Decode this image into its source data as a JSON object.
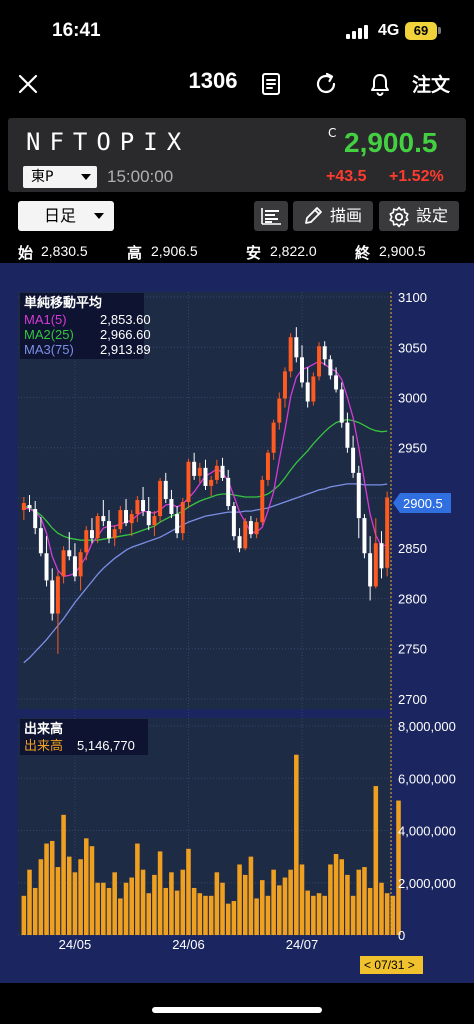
{
  "status_bar": {
    "time": "16:41",
    "network": "4G",
    "battery": "69"
  },
  "nav": {
    "title": "1306",
    "order_label": "注文",
    "icons": [
      "close-icon",
      "document-icon",
      "refresh-icon",
      "bell-icon"
    ]
  },
  "quote": {
    "name": "NFTOPIX",
    "market": "東P",
    "time": "15:00:00",
    "close_marker": "C",
    "price": "2,900.5",
    "change": "+43.5",
    "change_pct": "+1.52%",
    "price_color": "#43d141",
    "change_color": "#ff3b30"
  },
  "toolbar": {
    "period": "日足",
    "draw_label": "描画",
    "settings_label": "設定",
    "icons": [
      "bar-list-icon",
      "pencil-icon",
      "gear-icon"
    ]
  },
  "ohlc": {
    "open_label": "始",
    "open": "2,830.5",
    "high_label": "高",
    "high": "2,906.5",
    "low_label": "安",
    "low": "2,822.0",
    "close_label": "終",
    "close": "2,900.5"
  },
  "indicators": {
    "title": "単純移動平均",
    "ma1_label": "MA1(5)",
    "ma1_value": "2,853.60",
    "ma2_label": "MA2(25)",
    "ma2_value": "2,966.60",
    "ma3_label": "MA3(75)",
    "ma3_value": "2,913.89"
  },
  "volume_legend": {
    "title": "出来高",
    "label": "出来高",
    "value": "5,146,770"
  },
  "current_price_tag": "2900.5",
  "cursor_date": "< 07/31 >",
  "colors": {
    "background": "#1b2660",
    "up": "#ff5a1f",
    "down": "#ffffff",
    "ma1": "#d63ad6",
    "ma2": "#36c43e",
    "ma3": "#7c8fe6",
    "volume": "#f0a020"
  },
  "chart_data": {
    "type": "candlestick",
    "price_axis": {
      "ticks": [
        2700,
        2750,
        2800,
        2850,
        2900,
        2950,
        3000,
        3050,
        3100
      ],
      "range": [
        2690,
        3105
      ]
    },
    "volume_axis": {
      "ticks": [
        0,
        2000000,
        4000000,
        6000000,
        8000000
      ],
      "tick_labels": [
        "0",
        "2,000,000",
        "4,000,000",
        "6,000,000",
        "8,000,000"
      ],
      "range": [
        0,
        8000000
      ]
    },
    "x_tick_labels": [
      {
        "label": "24/05",
        "index": 9
      },
      {
        "label": "24/06",
        "index": 29
      },
      {
        "label": "24/07",
        "index": 49
      }
    ],
    "ohlc": [
      [
        2888,
        2901,
        2878,
        2895
      ],
      [
        2893,
        2903,
        2886,
        2890
      ],
      [
        2889,
        2897,
        2864,
        2870
      ],
      [
        2870,
        2881,
        2842,
        2845
      ],
      [
        2845,
        2862,
        2812,
        2818
      ],
      [
        2818,
        2830,
        2778,
        2785
      ],
      [
        2785,
        2827,
        2745,
        2822
      ],
      [
        2822,
        2852,
        2815,
        2848
      ],
      [
        2848,
        2866,
        2838,
        2842
      ],
      [
        2842,
        2855,
        2817,
        2822
      ],
      [
        2822,
        2849,
        2808,
        2846
      ],
      [
        2846,
        2872,
        2838,
        2868
      ],
      [
        2868,
        2880,
        2855,
        2860
      ],
      [
        2860,
        2885,
        2855,
        2882
      ],
      [
        2882,
        2898,
        2872,
        2877
      ],
      [
        2877,
        2888,
        2855,
        2860
      ],
      [
        2860,
        2873,
        2852,
        2869
      ],
      [
        2869,
        2892,
        2865,
        2888
      ],
      [
        2888,
        2899,
        2872,
        2875
      ],
      [
        2875,
        2888,
        2862,
        2884
      ],
      [
        2884,
        2902,
        2876,
        2898
      ],
      [
        2898,
        2911,
        2882,
        2887
      ],
      [
        2887,
        2901,
        2868,
        2873
      ],
      [
        2873,
        2887,
        2862,
        2882
      ],
      [
        2882,
        2920,
        2876,
        2917
      ],
      [
        2917,
        2925,
        2895,
        2899
      ],
      [
        2899,
        2908,
        2880,
        2884
      ],
      [
        2884,
        2892,
        2860,
        2865
      ],
      [
        2865,
        2900,
        2858,
        2896
      ],
      [
        2896,
        2939,
        2890,
        2936
      ],
      [
        2936,
        2945,
        2918,
        2922
      ],
      [
        2922,
        2935,
        2915,
        2930
      ],
      [
        2930,
        2938,
        2908,
        2912
      ],
      [
        2912,
        2922,
        2902,
        2918
      ],
      [
        2918,
        2938,
        2914,
        2932
      ],
      [
        2932,
        2940,
        2917,
        2920
      ],
      [
        2920,
        2928,
        2888,
        2892
      ],
      [
        2892,
        2896,
        2858,
        2862
      ],
      [
        2862,
        2870,
        2846,
        2850
      ],
      [
        2850,
        2880,
        2848,
        2877
      ],
      [
        2877,
        2882,
        2860,
        2864
      ],
      [
        2864,
        2880,
        2860,
        2876
      ],
      [
        2876,
        2922,
        2873,
        2918
      ],
      [
        2918,
        2948,
        2912,
        2945
      ],
      [
        2945,
        2978,
        2938,
        2975
      ],
      [
        2975,
        3005,
        2968,
        2999
      ],
      [
        2999,
        3030,
        2990,
        3026
      ],
      [
        3026,
        3064,
        3020,
        3060
      ],
      [
        3060,
        3070,
        3035,
        3040
      ],
      [
        3040,
        3052,
        3010,
        3015
      ],
      [
        3015,
        3030,
        2990,
        2996
      ],
      [
        2996,
        3025,
        2992,
        3021
      ],
      [
        3021,
        3055,
        3017,
        3051
      ],
      [
        3051,
        3056,
        3032,
        3038
      ],
      [
        3038,
        3042,
        3018,
        3022
      ],
      [
        3022,
        3030,
        3005,
        3008
      ],
      [
        3008,
        3015,
        2970,
        2975
      ],
      [
        2975,
        2985,
        2945,
        2950
      ],
      [
        2950,
        2962,
        2920,
        2925
      ],
      [
        2925,
        2932,
        2860,
        2880
      ],
      [
        2880,
        2884,
        2840,
        2845
      ],
      [
        2845,
        2862,
        2798,
        2812
      ],
      [
        2812,
        2880,
        2810,
        2855
      ],
      [
        2855,
        2867,
        2820,
        2830
      ],
      [
        2830.5,
        2906.5,
        2822,
        2900.5
      ]
    ],
    "ma1": [
      2890,
      2889,
      2886,
      2880,
      2865,
      2842,
      2828,
      2822,
      2823,
      2825,
      2833,
      2842,
      2855,
      2862,
      2870,
      2872,
      2872,
      2874,
      2876,
      2878,
      2883,
      2887,
      2886,
      2885,
      2888,
      2893,
      2894,
      2891,
      2894,
      2900,
      2906,
      2914,
      2922,
      2925,
      2929,
      2925,
      2917,
      2902,
      2886,
      2876,
      2866,
      2866,
      2871,
      2887,
      2906,
      2938,
      2968,
      3001,
      3020,
      3028,
      3030,
      3033,
      3036,
      3033,
      3029,
      3026,
      3018,
      3000,
      2980,
      2950,
      2916,
      2884,
      2863,
      2852,
      2853.6
    ],
    "ma2": [
      2892,
      2890,
      2887,
      2883,
      2877,
      2870,
      2865,
      2862,
      2860,
      2859,
      2858,
      2858,
      2858,
      2858,
      2859,
      2860,
      2861,
      2862,
      2863,
      2864,
      2866,
      2868,
      2870,
      2872,
      2876,
      2879,
      2882,
      2884,
      2887,
      2891,
      2894,
      2897,
      2899,
      2901,
      2903,
      2904,
      2904,
      2903,
      2902,
      2901,
      2901,
      2901,
      2902,
      2904,
      2908,
      2913,
      2920,
      2928,
      2935,
      2941,
      2947,
      2954,
      2960,
      2966,
      2971,
      2975,
      2977,
      2978,
      2977,
      2975,
      2972,
      2969,
      2967,
      2966,
      2966.6
    ],
    "ma3": [
      2736,
      2741,
      2747,
      2753,
      2759,
      2766,
      2773,
      2780,
      2788,
      2796,
      2803,
      2810,
      2817,
      2824,
      2830,
      2835,
      2840,
      2844,
      2848,
      2851,
      2853,
      2855,
      2857,
      2859,
      2861,
      2864,
      2867,
      2870,
      2873,
      2876,
      2878,
      2880,
      2882,
      2883,
      2884,
      2885,
      2886,
      2886,
      2886,
      2887,
      2887,
      2888,
      2889,
      2890,
      2892,
      2894,
      2896,
      2898,
      2900,
      2902,
      2904,
      2906,
      2908,
      2909,
      2911,
      2912,
      2913,
      2914,
      2914,
      2914,
      2913,
      2913,
      2913,
      2913,
      2913.9
    ],
    "volume": [
      1500000,
      2500000,
      1800000,
      2900000,
      3500000,
      3600000,
      2600000,
      4600000,
      3000000,
      2400000,
      2900000,
      3700000,
      3400000,
      2000000,
      2000000,
      1800000,
      2400000,
      1400000,
      2000000,
      2200000,
      3500000,
      2500000,
      1600000,
      2300000,
      3200000,
      1800000,
      2400000,
      1700000,
      2500000,
      3300000,
      1800000,
      1600000,
      1500000,
      1500000,
      2400000,
      2000000,
      1200000,
      1300000,
      2700000,
      2300000,
      3000000,
      1400000,
      2100000,
      1500000,
      2500000,
      1900000,
      2200000,
      2500000,
      6900000,
      2700000,
      1700000,
      1500000,
      1600000,
      1500000,
      2700000,
      3100000,
      2900000,
      2300000,
      1500000,
      2500000,
      2600000,
      1800000,
      5700000,
      2000000,
      1600000,
      1500000,
      5146770
    ]
  }
}
